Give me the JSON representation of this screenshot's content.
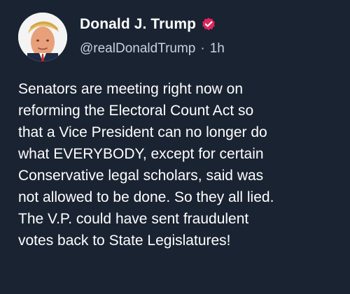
{
  "post": {
    "author": {
      "display_name": "Donald J. Trump",
      "handle": "@realDonaldTrump",
      "verified_icon": "verified-badge-icon",
      "avatar_icon": "avatar"
    },
    "meta": {
      "separator": "·",
      "relative_time": "1h"
    },
    "body_lines": [
      "Senators are meeting right now on",
      "reforming the Electoral Count Act so",
      "that a Vice President can no longer do",
      "what EVERYBODY, except for certain",
      "Conservative legal scholars, said was",
      "not allowed to be done. So they all lied.",
      "The V.P. could have sent fraudulent",
      "votes back to State Legislatures!"
    ]
  },
  "colors": {
    "background": "#1a2332",
    "text_primary": "#ffffff",
    "text_secondary": "#c9d1dc",
    "verified_badge": "#e0245e"
  }
}
